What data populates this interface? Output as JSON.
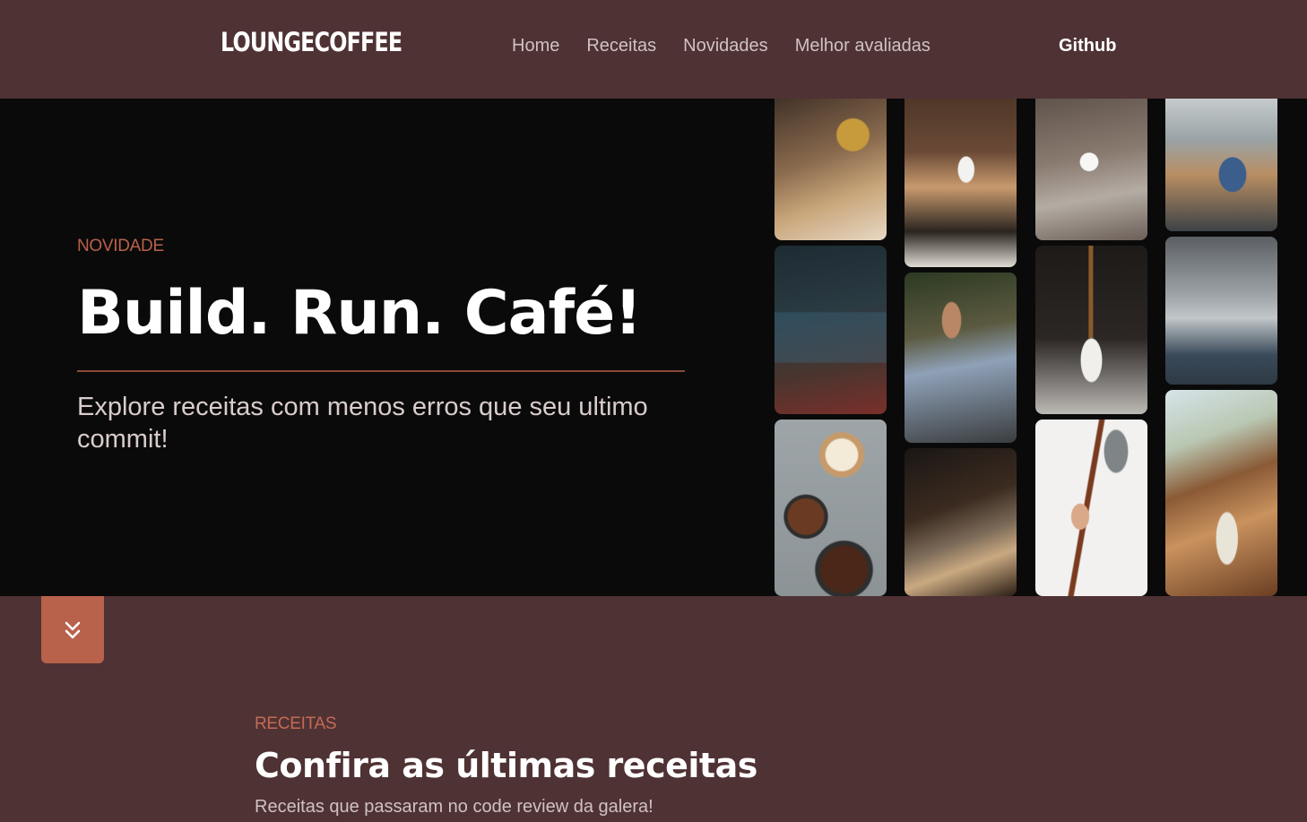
{
  "header": {
    "logo": "LOUNGECOFFEE",
    "nav": [
      "Home",
      "Receitas",
      "Novidades",
      "Melhor avaliadas"
    ],
    "github": "Github"
  },
  "hero": {
    "kicker": "NOVIDADE",
    "title": "Build. Run. Café!",
    "subtitle": "Explore receitas com menos erros que seu ultimo commit!"
  },
  "gallery": [
    {
      "name": "barista-woman-photo",
      "icon": "barista"
    },
    {
      "name": "developer-laptop-photo",
      "icon": "laptop"
    },
    {
      "name": "coffee-beans-portafilter-photo",
      "icon": "beans"
    },
    {
      "name": "woman-drinking-coffee-photo",
      "icon": "cup"
    },
    {
      "name": "man-laptop-coffee-photo",
      "icon": "laptop"
    },
    {
      "name": "latte-art-pour-photo",
      "icon": "latte"
    },
    {
      "name": "steaming-cup-hand-photo",
      "icon": "cup"
    },
    {
      "name": "coffee-pour-cup-photo",
      "icon": "pour"
    },
    {
      "name": "milk-pitcher-pour-photo",
      "icon": "pour"
    },
    {
      "name": "office-team-photo",
      "icon": "people"
    },
    {
      "name": "baristas-machine-photo",
      "icon": "machine"
    },
    {
      "name": "window-desk-coffee-photo",
      "icon": "desk"
    }
  ],
  "colors": {
    "background": "#4f3234",
    "hero_bg": "#0b0a0a",
    "accent": "#b8614b"
  },
  "scroll_icon": "chevrons-down-icon",
  "receitas": {
    "kicker": "RECEITAS",
    "title": "Confira as últimas receitas",
    "subtitle": "Receitas que passaram no code review da galera!"
  }
}
